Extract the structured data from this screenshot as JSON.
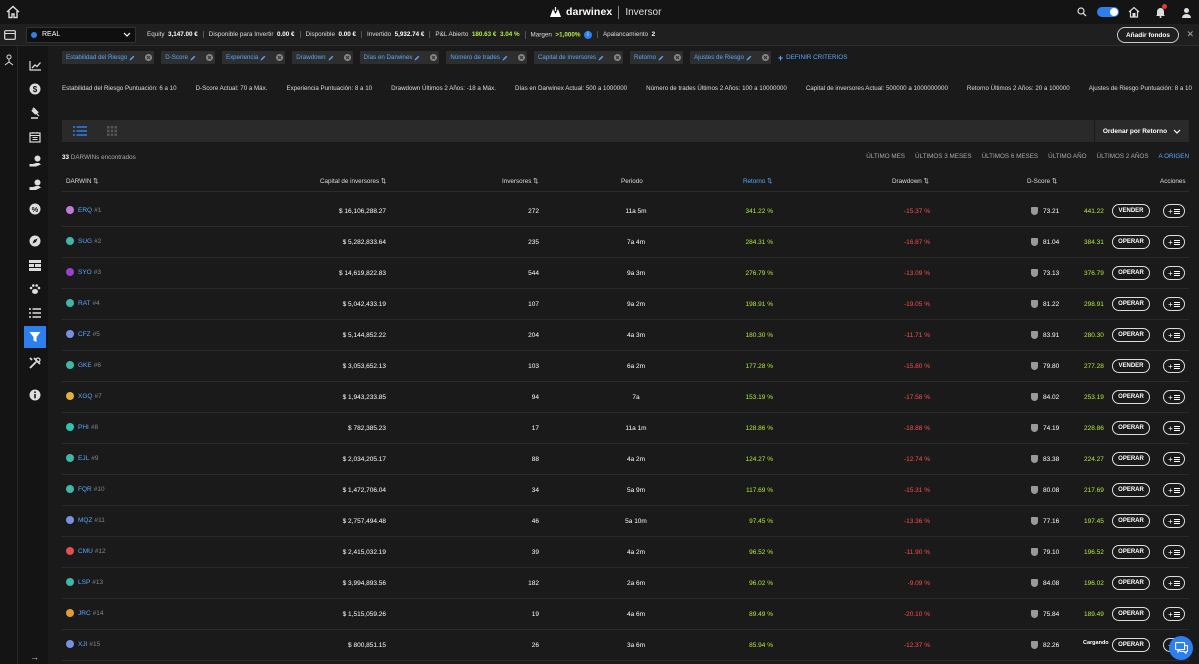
{
  "brand": {
    "name": "darwinex",
    "role": "Inversor"
  },
  "account": {
    "type": "REAL",
    "equity_label": "Equity",
    "equity": "3,147.00 €",
    "available_invest_label": "Disponible para Invertir",
    "available_invest": "0.00 €",
    "available_label": "Disponible",
    "available": "0.00 €",
    "invested_label": "Invertido",
    "invested": "5,932.74 €",
    "pnl_label": "P&L Abierto",
    "pnl": "180.63 €",
    "pnl_pct": "3.04 %",
    "margin_label": "Margen",
    "margin": ">1,000%",
    "margin_info": "i",
    "leverage_label": "Apalancamiento",
    "leverage": "2",
    "add_funds": "Añadir fondos"
  },
  "filters": [
    {
      "label": "Estabilidad del Riesgo"
    },
    {
      "label": "D-Score"
    },
    {
      "label": "Experiencia"
    },
    {
      "label": "Drawdown"
    },
    {
      "label": "Días en Darwinex"
    },
    {
      "label": "Número de trades"
    },
    {
      "label": "Capital de inversores"
    },
    {
      "label": "Retorno"
    },
    {
      "label": "Ajustes de Riesgo"
    }
  ],
  "define_criteria": "DEFINIR CRITERIOS",
  "criteria": [
    "Estabilidad del Riesgo Puntuación: 6 a 10",
    "D-Score Actual: 70 a Máx.",
    "Experiencia Puntuación: 8 a 10",
    "Drawdown Últimos 2 Años: -18 a Máx.",
    "Días en Darwinex Actual: 500 a 1000000",
    "Número de trades Últimos 2 Años: 100 a 10000000",
    "Capital de inversores Actual: 500000 a 1000000000",
    "Retorno Últimos 2 Años: 20 a 100000",
    "Ajustes de Riesgo Puntuación: 8 a 10"
  ],
  "sort_label": "Ordenar por Retorno",
  "found": {
    "count": "33",
    "label": "DARWINs encontrados"
  },
  "periods": [
    "ÚLTIMO MES",
    "ÚLTIMOS 3 MESES",
    "ÚLTIMOS 6 MESES",
    "ÚLTIMO AÑO",
    "ÚLTIMOS 2 AÑOS",
    "A ORIGEN"
  ],
  "active_period": "A ORIGEN",
  "columns": {
    "darwin": "DARWIN ⇅",
    "capital": "Capital de inversores ⇅",
    "investors": "Inversores ⇅",
    "period": "Periodo",
    "return": "Retorno ⇅",
    "drawdown": "Drawdown ⇅",
    "dscore": "D-Score ⇅",
    "actions": "Acciones"
  },
  "rows": [
    {
      "ticker": "ERQ",
      "num": "#1",
      "dot": "#c07ad8",
      "capital": "$ 16,106,288.27",
      "investors": "272",
      "period": "11a 5m",
      "ret": "341.22 %",
      "dd": "-15.37 %",
      "dscore": "73.21",
      "value": "441.22",
      "action": "VENDER"
    },
    {
      "ticker": "SUG",
      "num": "#2",
      "dot": "#3fb6a8",
      "capital": "$ 5,282,833.64",
      "investors": "235",
      "period": "7a 4m",
      "ret": "284.31 %",
      "dd": "-16.87 %",
      "dscore": "81.04",
      "value": "384.31",
      "action": "OPERAR"
    },
    {
      "ticker": "SYO",
      "num": "#3",
      "dot": "#9b3fcf",
      "capital": "$ 14,619,822.83",
      "investors": "544",
      "period": "9a 3m",
      "ret": "276.79 %",
      "dd": "-13.09 %",
      "dscore": "73.13",
      "value": "376.79",
      "action": "OPERAR"
    },
    {
      "ticker": "RAT",
      "num": "#4",
      "dot": "#3fb6a8",
      "capital": "$ 5,042,433.19",
      "investors": "107",
      "period": "9a 2m",
      "ret": "198.91 %",
      "dd": "-19.05 %",
      "dscore": "81.22",
      "value": "298.91",
      "action": "OPERAR"
    },
    {
      "ticker": "CFZ",
      "num": "#5",
      "dot": "#7a8fe0",
      "capital": "$ 5,144,852.22",
      "investors": "204",
      "period": "4a 3m",
      "ret": "180.30 %",
      "dd": "-11.71 %",
      "dscore": "83.91",
      "value": "280.30",
      "action": "OPERAR"
    },
    {
      "ticker": "GKE",
      "num": "#6",
      "dot": "#3fb6a8",
      "capital": "$ 3,053,652.13",
      "investors": "103",
      "period": "6a 2m",
      "ret": "177.28 %",
      "dd": "-15.80 %",
      "dscore": "79.80",
      "value": "277.28",
      "action": "VENDER"
    },
    {
      "ticker": "XGQ",
      "num": "#7",
      "dot": "#e0b03a",
      "capital": "$ 1,943,233.85",
      "investors": "94",
      "period": "7a",
      "ret": "153.19 %",
      "dd": "-17.58 %",
      "dscore": "84.02",
      "value": "253.19",
      "action": "OPERAR"
    },
    {
      "ticker": "PHI",
      "num": "#8",
      "dot": "#2fc4b2",
      "capital": "$ 782,385.23",
      "investors": "17",
      "period": "11a 1m",
      "ret": "128.86 %",
      "dd": "-18.88 %",
      "dscore": "74.19",
      "value": "228.86",
      "action": "OPERAR"
    },
    {
      "ticker": "EJL",
      "num": "#9",
      "dot": "#3fb6a8",
      "capital": "$ 2,034,205.17",
      "investors": "88",
      "period": "4a 2m",
      "ret": "124.27 %",
      "dd": "-12.74 %",
      "dscore": "83.38",
      "value": "224.27",
      "action": "OPERAR"
    },
    {
      "ticker": "FQR",
      "num": "#10",
      "dot": "#3fb6a8",
      "capital": "$ 1,472,706.04",
      "investors": "34",
      "period": "5a 9m",
      "ret": "117.69 %",
      "dd": "-15.31 %",
      "dscore": "80.08",
      "value": "217.69",
      "action": "OPERAR"
    },
    {
      "ticker": "MQZ",
      "num": "#11",
      "dot": "#7a8fe0",
      "capital": "$ 2,757,494.48",
      "investors": "46",
      "period": "5a 10m",
      "ret": "97.45 %",
      "dd": "-13.36 %",
      "dscore": "77.16",
      "value": "197.45",
      "action": "OPERAR"
    },
    {
      "ticker": "CMU",
      "num": "#12",
      "dot": "#e05050",
      "capital": "$ 2,415,032.19",
      "investors": "39",
      "period": "4a 2m",
      "ret": "96.52 %",
      "dd": "-11.90 %",
      "dscore": "79.10",
      "value": "196.52",
      "action": "OPERAR"
    },
    {
      "ticker": "LSP",
      "num": "#13",
      "dot": "#3fb6a8",
      "capital": "$ 3,994,893.56",
      "investors": "182",
      "period": "2a 6m",
      "ret": "96.02 %",
      "dd": "-9.09 %",
      "dscore": "84.08",
      "value": "196.02",
      "action": "OPERAR"
    },
    {
      "ticker": "JRC",
      "num": "#14",
      "dot": "#e0a030",
      "capital": "$ 1,515,059.26",
      "investors": "19",
      "period": "4a 6m",
      "ret": "89.49 %",
      "dd": "-20.10 %",
      "dscore": "75.84",
      "value": "189.49",
      "action": "OPERAR"
    },
    {
      "ticker": "XJI",
      "num": "#15",
      "dot": "#7a8fe0",
      "capital": "$ 800,851.15",
      "investors": "26",
      "period": "3a 6m",
      "ret": "85.94 %",
      "dd": "-12.37 %",
      "dscore": "82.26",
      "value": "",
      "loading": "Cargando",
      "action": "OPERAR"
    }
  ]
}
